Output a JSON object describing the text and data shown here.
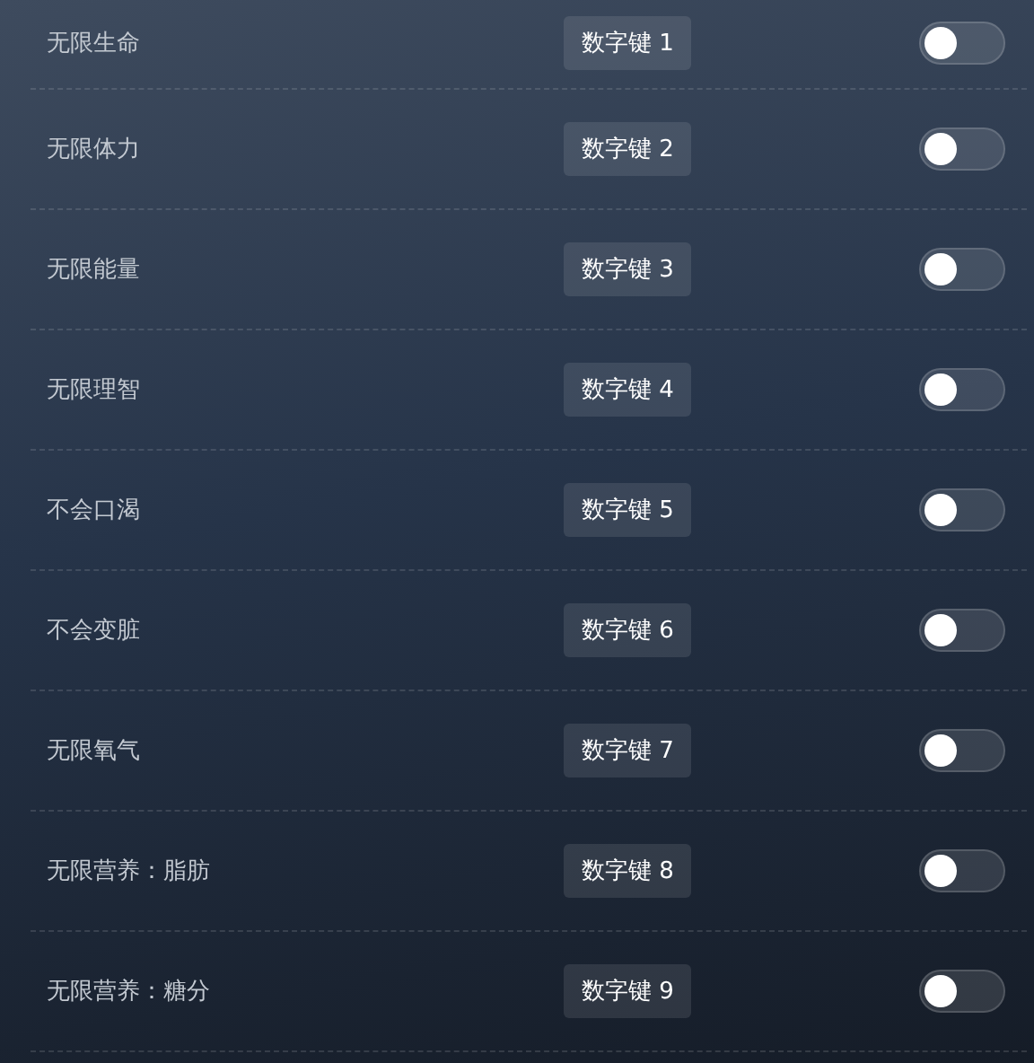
{
  "cheats": [
    {
      "label": "无限生命",
      "hotkey": "数字键 1",
      "on": false
    },
    {
      "label": "无限体力",
      "hotkey": "数字键 2",
      "on": false
    },
    {
      "label": "无限能量",
      "hotkey": "数字键 3",
      "on": false
    },
    {
      "label": "无限理智",
      "hotkey": "数字键 4",
      "on": false
    },
    {
      "label": "不会口渴",
      "hotkey": "数字键 5",
      "on": false
    },
    {
      "label": "不会变脏",
      "hotkey": "数字键 6",
      "on": false
    },
    {
      "label": "无限氧气",
      "hotkey": "数字键 7",
      "on": false
    },
    {
      "label": "无限营养：脂肪",
      "hotkey": "数字键 8",
      "on": false
    },
    {
      "label": "无限营养：糖分",
      "hotkey": "数字键 9",
      "on": false
    }
  ]
}
